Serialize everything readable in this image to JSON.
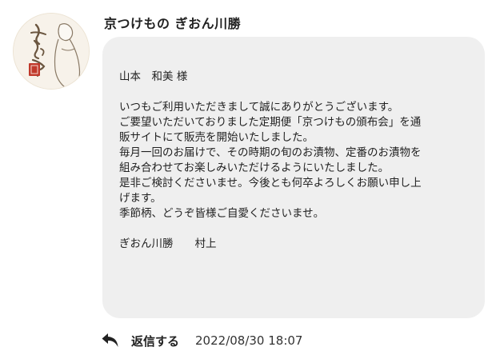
{
  "sender": {
    "name": "京つけもの ぎおん川勝",
    "avatar_icon": "shop-logo-avatar"
  },
  "message": {
    "lines": [
      "山本　和美 様",
      "",
      "いつもご利用いただきまして誠にありがとうございます。",
      "ご要望いただいておりました定期便「京つけもの頒布会」を通",
      "販サイトにて販売を開始いたしました。",
      "毎月一回のお届けで、その時期の旬のお漬物、定番のお漬物を",
      "組み合わせてお楽しみいただけるようにいたしました。",
      "是非ご検討くださいませ。今後とも何卒よろしくお願い申し上",
      "げます。",
      "季節柄、どうぞ皆様ご自愛くださいませ。",
      "",
      "ぎおん川勝　　村上"
    ]
  },
  "footer": {
    "reply_label": "返信する",
    "reply_icon": "reply-arrow-icon",
    "timestamp": "2022/08/30 18:07"
  }
}
